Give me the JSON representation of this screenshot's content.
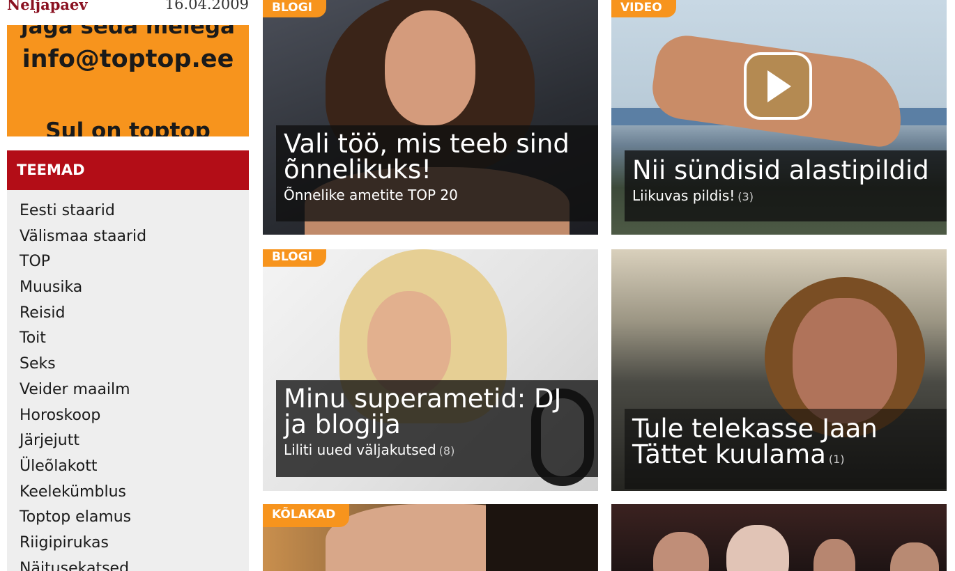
{
  "header": {
    "weekday": "Neljapaev",
    "date": "16.04.2009"
  },
  "promo": {
    "line1": "jaga seda meiega",
    "email": "info@toptop.ee",
    "line3": "Sul on toptop infot?"
  },
  "sidebar": {
    "heading": "TEEMAD",
    "items": [
      {
        "label": "Eesti staarid"
      },
      {
        "label": "Välismaa staarid"
      },
      {
        "label": "TOP"
      },
      {
        "label": "Muusika"
      },
      {
        "label": "Reisid"
      },
      {
        "label": "Toit"
      },
      {
        "label": "Seks"
      },
      {
        "label": "Veider maailm"
      },
      {
        "label": "Horoskoop"
      },
      {
        "label": "Järjejutt"
      },
      {
        "label": "Üleõlakott"
      },
      {
        "label": "Keelekümblus"
      },
      {
        "label": "Toptop elamus"
      },
      {
        "label": "Riigipirukas"
      },
      {
        "label": "Näitusekatsed"
      }
    ]
  },
  "cards": [
    {
      "tag": "BLOGI",
      "title": "Vali töö, mis teeb sind õnnelikuks!",
      "subtitle": "Õnnelike ametite TOP 20",
      "count": ""
    },
    {
      "tag": "VIDEO",
      "title": "Nii sündisid alastipildid",
      "subtitle": "Liikuvas pildis!",
      "count": "(3)",
      "icon": "play-icon"
    },
    {
      "tag": "BLOGI",
      "title": "Minu superametid: DJ ja blogija",
      "subtitle": "Liliti uued väljakutsed",
      "count": "(8)"
    },
    {
      "tag": "",
      "title": "Tule telekasse Jaan Tättet kuulama",
      "subtitle": "",
      "count": "(1)"
    },
    {
      "tag": "KÕLAKAD"
    },
    {
      "tag": ""
    }
  ],
  "colors": {
    "accent_orange": "#f7941d",
    "sidebar_red": "#b30d17",
    "weekday_red": "#8a1020"
  }
}
